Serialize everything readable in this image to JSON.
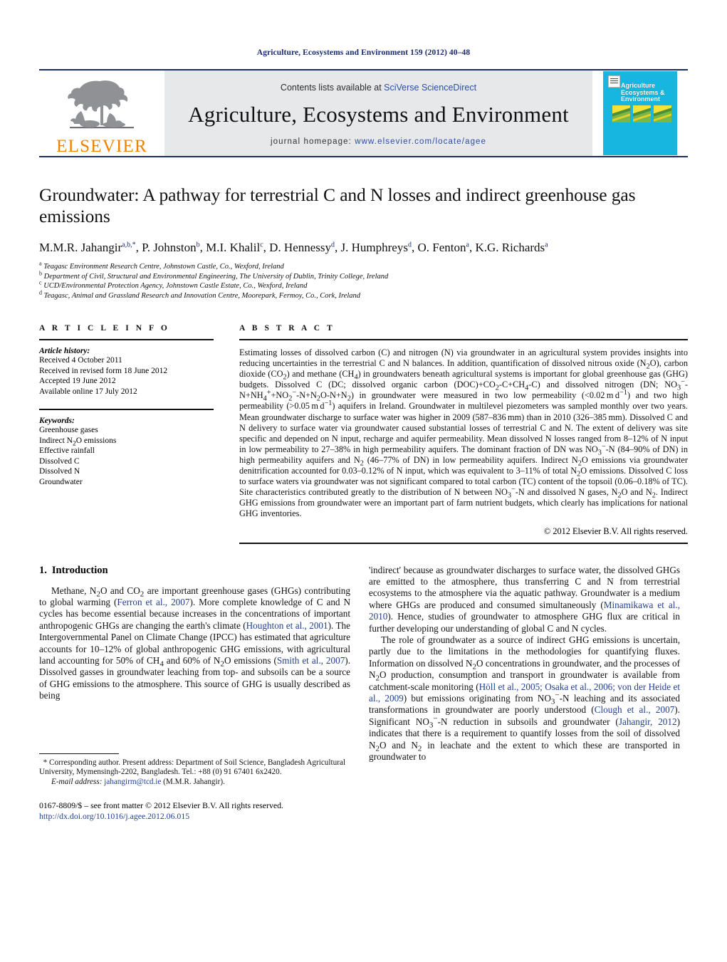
{
  "running_head": "Agriculture, Ecosystems and Environment 159 (2012) 40–48",
  "masthead": {
    "publisher_name": "ELSEVIER",
    "contents_prefix": "Contents lists available at ",
    "contents_link": "SciVerse ScienceDirect",
    "journal_title": "Agriculture, Ecosystems and Environment",
    "homepage_prefix": "journal homepage: ",
    "homepage_url": "www.elsevier.com/locate/agee",
    "cover_title": "Agriculture Ecosystems & Environment",
    "cover_color": "#17b6e0"
  },
  "article": {
    "title": "Groundwater: A pathway for terrestrial C and N losses and indirect greenhouse gas emissions",
    "authors": [
      {
        "name": "M.M.R. Jahangir",
        "marks": "a,b,*"
      },
      {
        "name": "P. Johnston",
        "marks": "b"
      },
      {
        "name": "M.I. Khalil",
        "marks": "c"
      },
      {
        "name": "D. Hennessy",
        "marks": "d"
      },
      {
        "name": "J. Humphreys",
        "marks": "d"
      },
      {
        "name": "O. Fenton",
        "marks": "a"
      },
      {
        "name": "K.G. Richards",
        "marks": "a"
      }
    ],
    "affiliations": [
      {
        "mark": "a",
        "text": "Teagasc Environment Research Centre, Johnstown Castle, Co., Wexford, Ireland"
      },
      {
        "mark": "b",
        "text": "Department of Civil, Structural and Environmental Engineering, The University of Dublin, Trinity College, Ireland"
      },
      {
        "mark": "c",
        "text": "UCD/Environmental Protection Agency, Johnstown Castle Estate, Co., Wexford, Ireland"
      },
      {
        "mark": "d",
        "text": "Teagasc, Animal and Grassland Research and Innovation Centre, Moorepark, Fermoy, Co., Cork, Ireland"
      }
    ]
  },
  "article_info": {
    "heading": "A R T I C L E    I N F O",
    "history_label": "Article history:",
    "history": [
      "Received 4 October 2011",
      "Received in revised form 18 June 2012",
      "Accepted 19 June 2012",
      "Available online 17 July 2012"
    ],
    "keywords_label": "Keywords:",
    "keywords": [
      "Greenhouse gases",
      "Indirect N2O emissions",
      "Effective rainfall",
      "Dissolved C",
      "Dissolved N",
      "Groundwater"
    ]
  },
  "abstract": {
    "heading": "A B S T R A C T",
    "copyright": "© 2012 Elsevier B.V. All rights reserved."
  },
  "introduction": {
    "heading_number": "1.",
    "heading_text": "Introduction"
  },
  "footnotes": {
    "corresponding_star": "*",
    "email_label": "E-mail address:",
    "email": "jahangirm@tcd.ie",
    "email_person": "(M.M.R. Jahangir).",
    "issn_line": "0167-8809/$ – see front matter © 2012 Elsevier B.V. All rights reserved.",
    "doi": "http://dx.doi.org/10.1016/j.agee.2012.06.015"
  }
}
